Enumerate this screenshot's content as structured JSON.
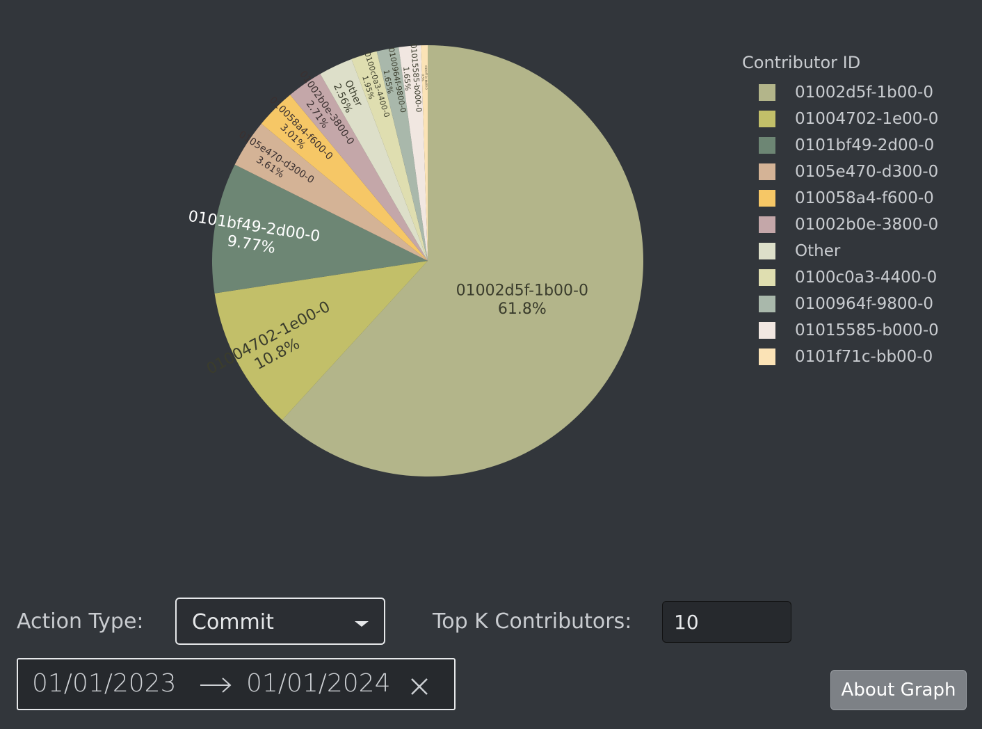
{
  "chart_data": {
    "type": "pie",
    "legend_title": "Contributor ID",
    "slices": [
      {
        "label": "01002d5f-1b00-0",
        "percent": 61.8,
        "color": "#b3b58a",
        "text_color": "#3a3c2c"
      },
      {
        "label": "01004702-1e00-0",
        "percent": 10.8,
        "color": "#c2bf69",
        "text_color": "#3a3c2c"
      },
      {
        "label": "0101bf49-2d00-0",
        "percent": 9.77,
        "color": "#6d8674",
        "text_color": "#ffffff"
      },
      {
        "label": "0105e470-d300-0",
        "percent": 3.61,
        "color": "#d4b396",
        "text_color": "#3a3030"
      },
      {
        "label": "010058a4-f600-0",
        "percent": 3.01,
        "color": "#f6c766",
        "text_color": "#3a3030"
      },
      {
        "label": "01002b0e-3800-0",
        "percent": 2.71,
        "color": "#c4a7a9",
        "text_color": "#3a3030"
      },
      {
        "label": "Other",
        "percent": 2.56,
        "color": "#dddfc9",
        "text_color": "#3a3c2c"
      },
      {
        "label": "0100c0a3-4400-0",
        "percent": 1.95,
        "color": "#dfdeb0",
        "text_color": "#3a3c2c"
      },
      {
        "label": "0100964f-9800-0",
        "percent": 1.65,
        "color": "#a9b8ab",
        "text_color": "#3a3c2c"
      },
      {
        "label": "01015585-b000-0",
        "percent": 1.65,
        "color": "#f1e7e1",
        "text_color": "#3a3c2c"
      },
      {
        "label": "0101f71c-bb00-0",
        "percent": 0.5,
        "color": "#fbe3b6",
        "text_color": "#3a3c2c"
      }
    ],
    "legend_placement": "right"
  },
  "controls": {
    "action_type_label": "Action Type:",
    "action_type_value": "Commit",
    "top_k_label": "Top K Contributors:",
    "top_k_value": "10",
    "date_start": "01/01/2023",
    "date_end": "01/01/2024",
    "about_button": "About Graph"
  }
}
